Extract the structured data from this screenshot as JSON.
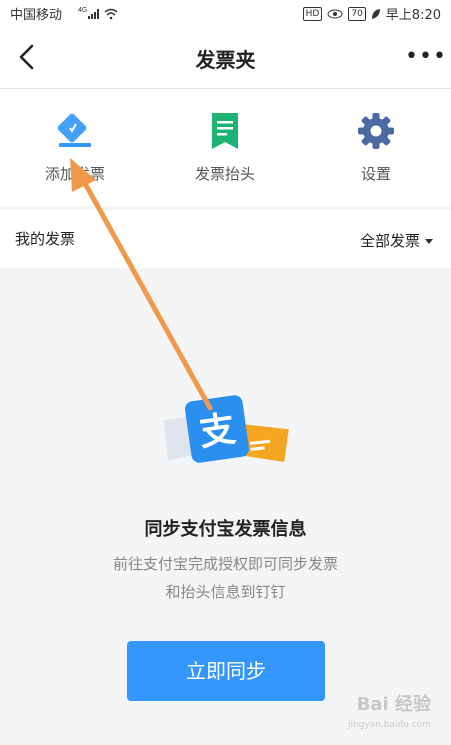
{
  "status_bar": {
    "carrier": "中国移动",
    "network": "4G",
    "hd": "HD",
    "battery": "70",
    "time": "早上8:20"
  },
  "navbar": {
    "title": "发票夹",
    "more": "•••"
  },
  "actions": [
    {
      "label": "添加发票",
      "icon": "invoice-add-icon"
    },
    {
      "label": "发票抬头",
      "icon": "invoice-title-icon"
    },
    {
      "label": "设置",
      "icon": "gear-icon"
    }
  ],
  "section": {
    "title": "我的发票",
    "filter": "全部发票"
  },
  "empty": {
    "title": "同步支付宝发票信息",
    "desc_line1": "前往支付宝完成授权即可同步发票",
    "desc_line2": "和抬头信息到钉钉",
    "art_glyph": "支",
    "button": "立即同步"
  },
  "watermark": {
    "brand": "Bai 经验",
    "url": "jingyan.baidu.com"
  },
  "colors": {
    "primary": "#3296fa",
    "green": "#1db372",
    "arrow": "#f0994a"
  }
}
